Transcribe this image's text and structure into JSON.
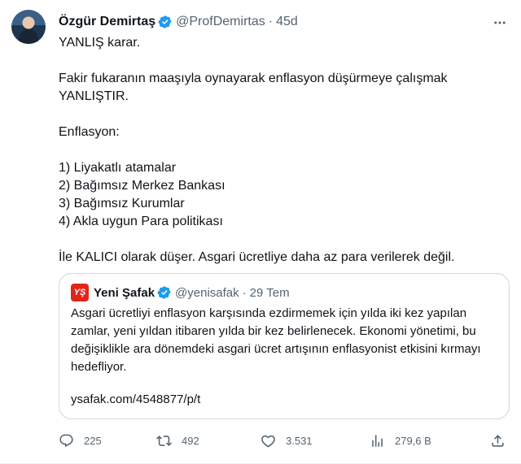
{
  "author": {
    "name": "Özgür Demirtaş",
    "handle": "@ProfDemirtas",
    "separator": "·",
    "time": "45d"
  },
  "tweet": {
    "lines": [
      "YANLIŞ karar.",
      "",
      "Fakir fukaranın maaşıyla oynayarak enflasyon düşürmeye çalışmak YANLIŞTIR.",
      "",
      "Enflasyon:",
      "",
      "1) Liyakatlı atamalar",
      "2) Bağımsız Merkez Bankası",
      "3) Bağımsız Kurumlar",
      "4) Akla uygun Para politikası",
      "",
      "İle KALICI olarak düşer. Asgari ücretliye daha az para verilerek değil."
    ]
  },
  "quote": {
    "avatar_text": "YŞ",
    "name": "Yeni Şafak",
    "handle": "@yenisafak",
    "separator": "·",
    "time": "29 Tem",
    "text": "Asgari ücretliyi enflasyon karşısında ezdirmemek için yılda iki kez yapılan zamlar, yeni yıldan itibaren yılda bir kez belirlenecek. Ekonomi yönetimi, bu değişiklikle ara dönemdeki asgari ücret artışının enflasyonist etkisini kırmayı hedefliyor.",
    "link": "ysafak.com/4548877/p/t"
  },
  "actions": {
    "replies": "225",
    "retweets": "492",
    "likes": "3.531",
    "views": "279,6 B"
  },
  "colors": {
    "text": "#0f1419",
    "muted": "#536471",
    "verified": "#1d9bf0",
    "brand_red": "#e1251b",
    "border": "#cfd9de"
  },
  "icons": [
    "verified-badge-icon",
    "more-icon",
    "reply-icon",
    "retweet-icon",
    "like-icon",
    "views-icon",
    "share-icon"
  ]
}
